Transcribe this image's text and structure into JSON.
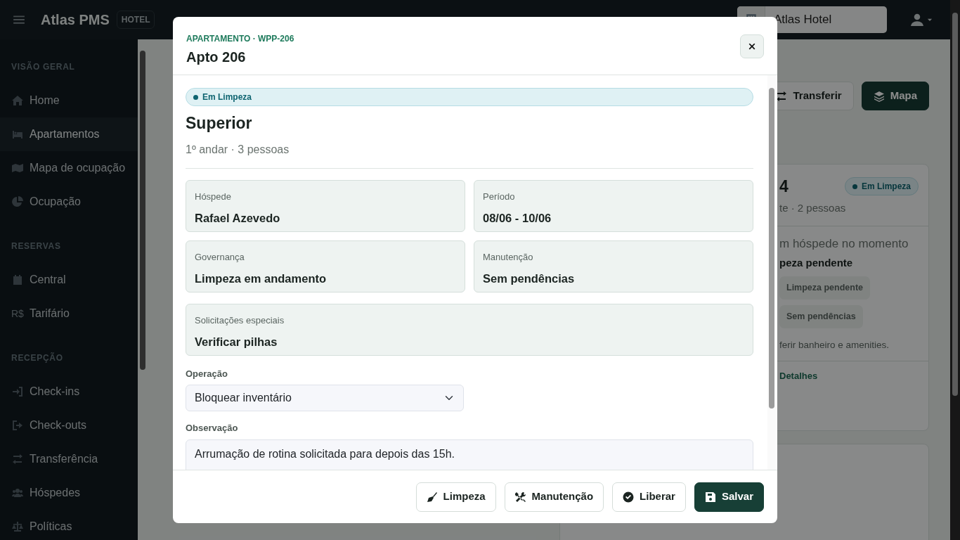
{
  "topbar": {
    "brand": "Atlas PMS",
    "brand_tag": "HOTEL",
    "hotel": "Atlas Hotel"
  },
  "sidebar": {
    "sections": [
      {
        "title": "VISÃO GERAL",
        "items": [
          {
            "label": "Home",
            "selected": false
          },
          {
            "label": "Apartamentos",
            "selected": true
          },
          {
            "label": "Mapa de ocupação",
            "selected": false
          },
          {
            "label": "Ocupação",
            "selected": false
          }
        ]
      },
      {
        "title": "RESERVAS",
        "items": [
          {
            "label": "Central",
            "selected": false
          },
          {
            "label": "Tarifário",
            "selected": false,
            "glyph": "R$"
          }
        ]
      },
      {
        "title": "RECEPÇÃO",
        "items": [
          {
            "label": "Check-ins",
            "selected": false
          },
          {
            "label": "Check-outs",
            "selected": false
          },
          {
            "label": "Transferência",
            "selected": false
          },
          {
            "label": "Hóspedes",
            "selected": false
          },
          {
            "label": "Políticas",
            "selected": false
          }
        ]
      }
    ]
  },
  "toolbar": [
    {
      "label": "Transferir",
      "kind": "outline"
    },
    {
      "label": "Mapa",
      "kind": "primary"
    }
  ],
  "room_card": {
    "number": "4",
    "status": "Em Limpeza",
    "subtitle": "te · 2 pessoas",
    "guest": "m hóspede no momento",
    "housekeeping": "peza pendente",
    "tags": [
      "Limpeza pendente",
      "Sem pendências"
    ],
    "note": "ferir banheiro e amenities.",
    "link": "Detalhes"
  },
  "modal": {
    "eyebrow": "APARTAMENTO · WPP-206",
    "title": "Apto 206",
    "status": "Em Limpeza",
    "category": "Superior",
    "subtitle": "1º andar · 3 pessoas",
    "fields": [
      {
        "label": "Hóspede",
        "value": "Rafael Azevedo",
        "wide": false
      },
      {
        "label": "Período",
        "value": "08/06 - 10/06",
        "wide": false
      },
      {
        "label": "Governança",
        "value": "Limpeza em andamento",
        "wide": false
      },
      {
        "label": "Manutenção",
        "value": "Sem pendências",
        "wide": false
      },
      {
        "label": "Solicitações especiais",
        "value": "Verificar pilhas",
        "wide": true
      }
    ],
    "operation": {
      "label": "Operação",
      "value": "Bloquear inventário"
    },
    "note": {
      "label": "Observação",
      "value": "Arrumação de rotina solicitada para depois das 15h."
    },
    "buttons": [
      {
        "label": "Limpeza",
        "kind": "outline"
      },
      {
        "label": "Manutenção",
        "kind": "outline"
      },
      {
        "label": "Liberar",
        "kind": "outline"
      },
      {
        "label": "Salvar",
        "kind": "primary"
      }
    ]
  }
}
